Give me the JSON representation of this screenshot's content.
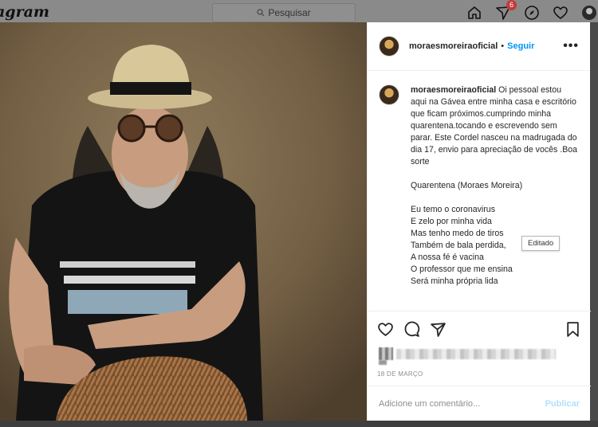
{
  "nav": {
    "logo": "agram",
    "search_placeholder": "Pesquisar",
    "activity_badge": "6"
  },
  "post": {
    "username": "moraesmoreiraoficial",
    "separator": "•",
    "follow_label": "Seguir",
    "more_label": "•••",
    "caption_user": "moraesmoreiraoficial",
    "caption_text": " Oi pessoal estou aqui na Gávea entre minha casa e escritório que ficam próximos.cumprindo minha quarentena.tocando e escrevendo sem parar. Este Cordel nasceu na madrugada do dia 17, envio para apreciação de vocês .Boa sorte",
    "subtitle": "Quarentena (Moraes Moreira)",
    "verse_lines": "Eu temo o coronavirus\nE zelo por minha vida\nMas tenho medo de tiros\nTambém de bala perdida,\nA nossa fé é vacina\nO professor que me ensina\nSerá minha própria lida",
    "edited_tooltip": "Editado",
    "date": "18 DE MARÇO",
    "comment_placeholder": "Adicione um comentário...",
    "publish_label": "Publicar"
  },
  "colors": {
    "accent": "#0095f6",
    "publish_disabled": "#b2dffc",
    "badge": "#c33a3a"
  },
  "icons": [
    "search-icon",
    "home-icon",
    "activity-icon",
    "explore-icon",
    "heart-icon",
    "comment-icon",
    "share-icon",
    "bookmark-icon",
    "more-icon"
  ]
}
